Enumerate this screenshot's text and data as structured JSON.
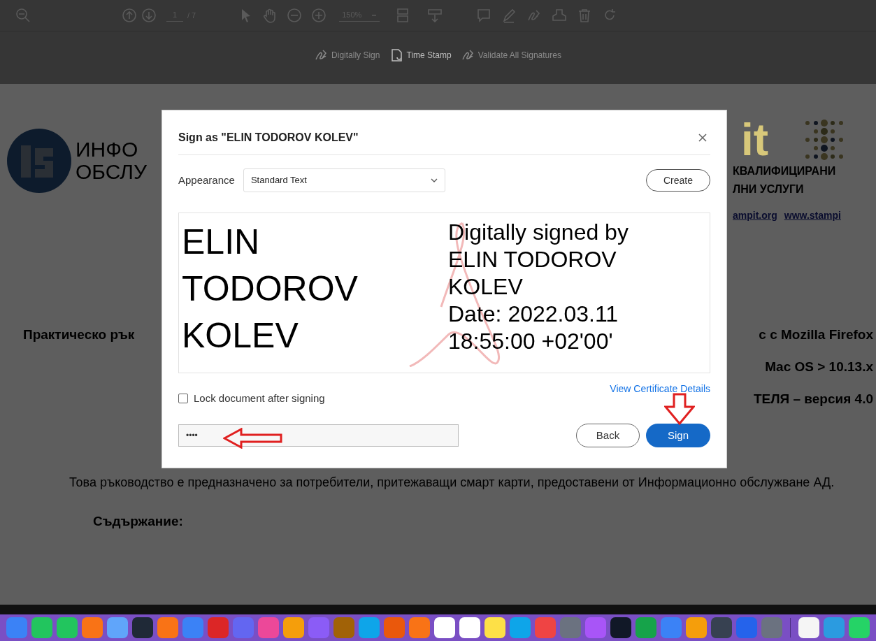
{
  "toolbar": {
    "page": "1",
    "page_total": "/ 7",
    "zoom": "150%"
  },
  "sign_toolbar": [
    {
      "label": "Digitally Sign",
      "disabled": true
    },
    {
      "label": "Time Stamp",
      "disabled": false
    },
    {
      "label": "Validate All Signatures",
      "disabled": true
    }
  ],
  "document": {
    "logo_left": [
      "ИНФО",
      "ОБСЛУ"
    ],
    "logo_right_word": "it",
    "logo_right_text": [
      "КВАЛИФИЦИРАНИ",
      "ЛНИ УСЛУГИ"
    ],
    "links": [
      "ampit.org",
      "www.stampi"
    ],
    "heading_left": "Практическо рък",
    "heading_right": [
      "с с Mozilla Firefox",
      "Mac OS > 10.13.x",
      "ТЕЛЯ – версия 4.0"
    ],
    "paragraph": "Това ръководство е предназначено за потребители, притежаващи смарт карти, предоставени от Информационно обслужване АД.",
    "section_title": "Съдържание:"
  },
  "dialog": {
    "title": "Sign as \"ELIN TODOROV KOLEV\"",
    "appearance_label": "Appearance",
    "appearance_value": "Standard Text",
    "create_button": "Create",
    "signature_name": [
      "ELIN",
      "TODOROV",
      "KOLEV"
    ],
    "signature_details": [
      "Digitally signed by",
      "ELIN TODOROV",
      "KOLEV",
      "Date: 2022.03.11",
      "18:55:00 +02'00'"
    ],
    "lock_checkbox": {
      "label": "Lock document after signing",
      "checked": false
    },
    "certificate_link": "View Certificate Details",
    "pin_value": "••••",
    "back_button": "Back",
    "sign_button": "Sign"
  }
}
